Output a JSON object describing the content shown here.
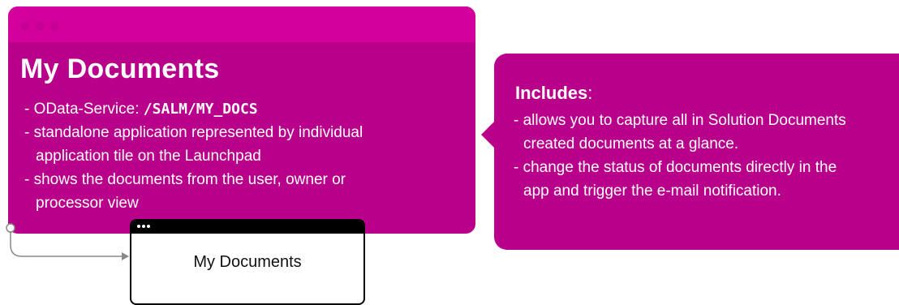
{
  "main_window": {
    "title": "My Documents",
    "bullets": [
      {
        "prefix": "- OData-Service: ",
        "code": "/SALM/MY_DOCS"
      },
      {
        "line1": "- standalone application represented by individual",
        "line2": "application tile on the Launchpad"
      },
      {
        "line1": "- shows the documents from the user, owner or",
        "line2": "processor view"
      }
    ]
  },
  "callout": {
    "heading": "Includes",
    "heading_suffix": ":",
    "bullets": [
      {
        "line1": "- allows you to capture all in Solution Documents",
        "line2": "created documents at a glance."
      },
      {
        "line1": "- change the status of documents directly in the",
        "line2": "app and trigger the e-mail notification."
      }
    ]
  },
  "tile": {
    "label": "My Documents"
  },
  "colors": {
    "magenta": "#b8008a",
    "magenta_titlebar": "#d4009b",
    "connector": "#888888"
  }
}
